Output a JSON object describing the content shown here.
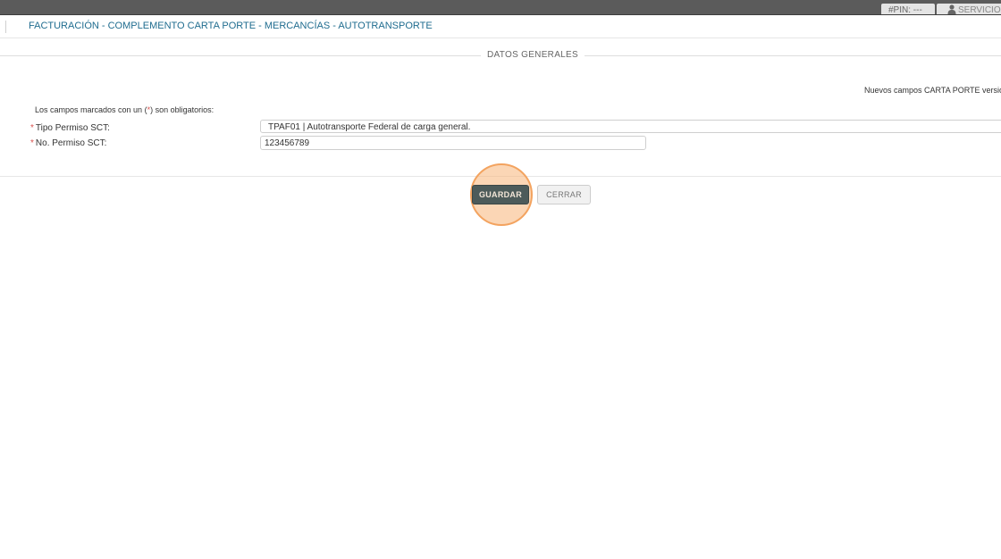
{
  "topbar": {
    "pin_label": "#PIN: ---",
    "user_label": "SERVICIO",
    "user_icon": "person-icon"
  },
  "header": {
    "title": "FACTURACIÓN - COMPLEMENTO CARTA PORTE - MERCANCÍAS - AUTOTRANSPORTE"
  },
  "section": {
    "title": "DATOS GENERALES"
  },
  "notice": "Nuevos campos CARTA PORTE versió",
  "required_note": {
    "prefix": "Los campos marcados con un (",
    "star": "*",
    "suffix": ") son obligatorios:"
  },
  "fields": {
    "tipo_permiso": {
      "required_mark": "*",
      "label": "Tipo Permiso SCT:",
      "value": "TPAF01 | Autotransporte Federal de carga general."
    },
    "no_permiso": {
      "required_mark": "*",
      "label": "No. Permiso SCT:",
      "value": "123456789"
    }
  },
  "buttons": {
    "save": "GUARDAR",
    "close": "CERRAR"
  },
  "colors": {
    "title_blue": "#1f6c8f",
    "required_red": "#d9534f",
    "save_bg": "#4d5b5a",
    "highlight": "#f3a35f"
  }
}
